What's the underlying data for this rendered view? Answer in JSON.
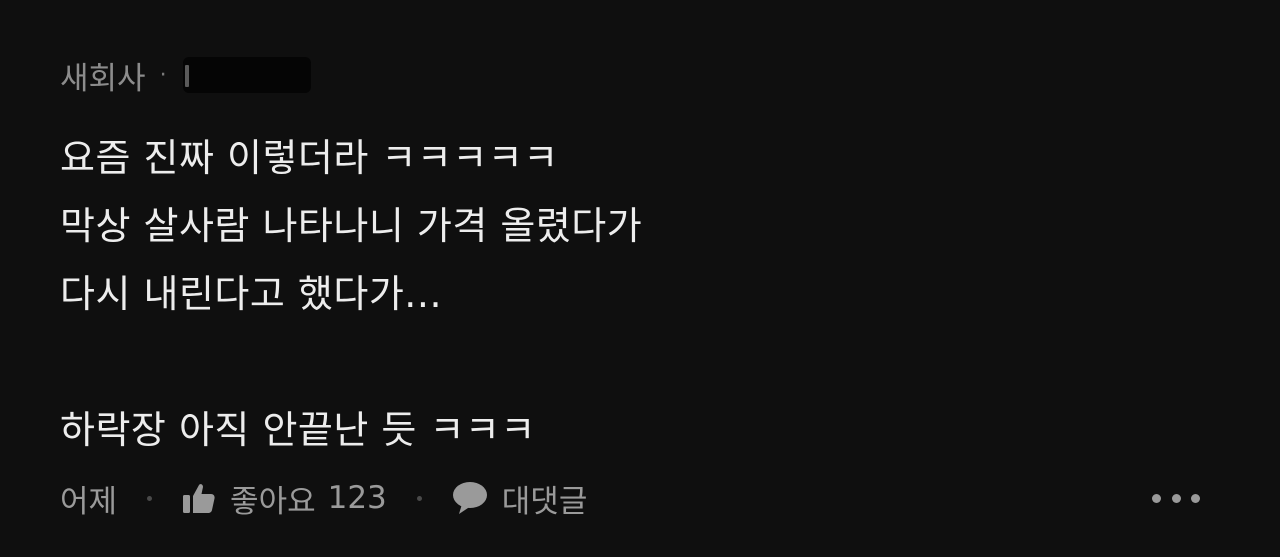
{
  "comment": {
    "author": "새회사",
    "separator": "·",
    "body_lines": [
      "요즘 진짜 이렇더라 ㅋㅋㅋㅋㅋ",
      "막상 살사람 나타나니 가격 올렸다가",
      "다시 내린다고 했다가...",
      "",
      "하락장 아직 안끝난 듯 ㅋㅋㅋ"
    ],
    "timestamp": "어제",
    "like_label": "좋아요",
    "like_count": "123",
    "reply_label": "대댓글",
    "icons": {
      "like": "thumbs-up-icon",
      "reply": "speech-bubble-icon",
      "more": "more-dots-icon"
    },
    "colors": {
      "background": "#0f0f0f",
      "text": "#ededed",
      "muted": "#8c8c8c"
    }
  }
}
